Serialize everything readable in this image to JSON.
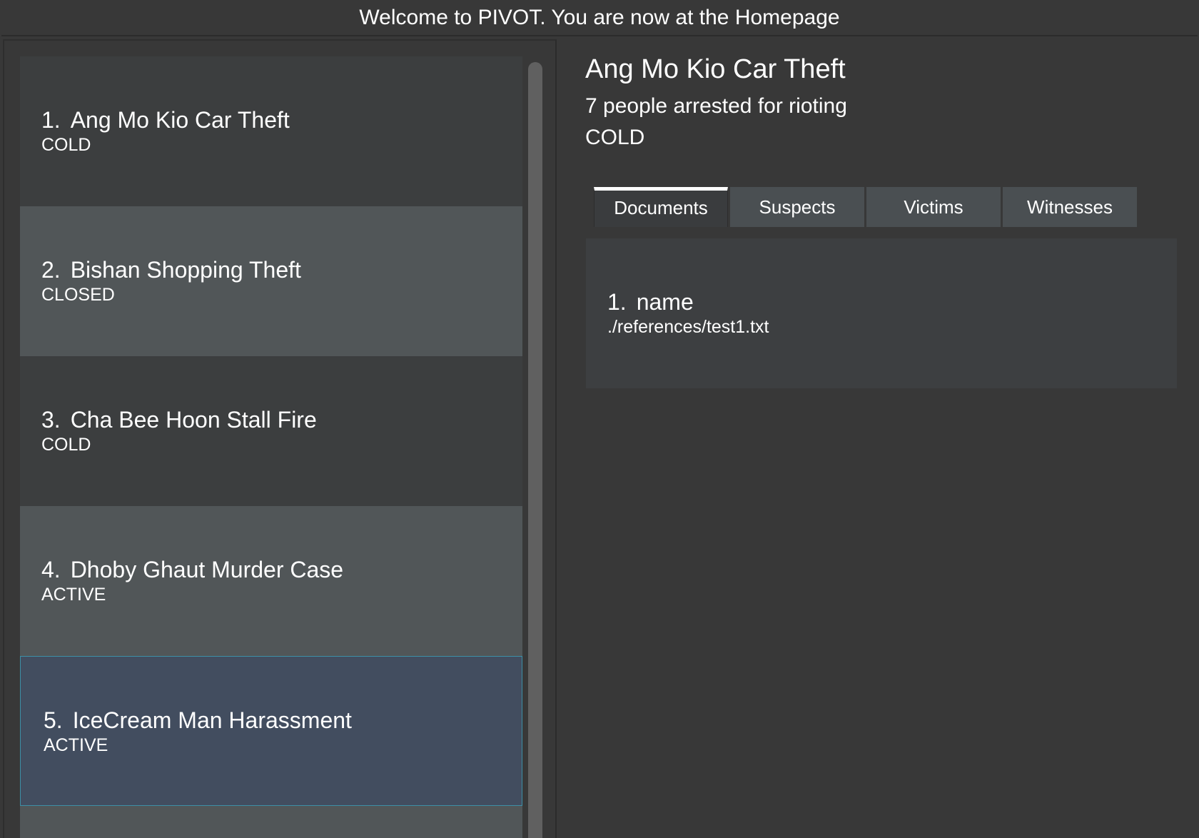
{
  "status_bar": {
    "message": "Welcome to PIVOT. You are now at the Homepage"
  },
  "case_list": {
    "items": [
      {
        "index": "1.",
        "title": "Ang Mo Kio Car Theft",
        "status": "COLD"
      },
      {
        "index": "2.",
        "title": "Bishan Shopping Theft",
        "status": "CLOSED"
      },
      {
        "index": "3.",
        "title": "Cha Bee Hoon Stall Fire",
        "status": "COLD"
      },
      {
        "index": "4.",
        "title": "Dhoby Ghaut Murder Case",
        "status": "ACTIVE"
      },
      {
        "index": "5.",
        "title": "IceCream Man Harassment",
        "status": "ACTIVE"
      }
    ],
    "selected_index": 5
  },
  "case_detail": {
    "title": "Ang Mo Kio Car Theft",
    "description": "7 people arrested for rioting",
    "status": "COLD",
    "tabs": [
      {
        "label": "Documents",
        "active": true
      },
      {
        "label": "Suspects",
        "active": false
      },
      {
        "label": "Victims",
        "active": false
      },
      {
        "label": "Witnesses",
        "active": false
      }
    ],
    "documents": [
      {
        "index": "1.",
        "name": "name",
        "path": "./references/test1.txt"
      }
    ]
  },
  "colors": {
    "background": "#383838",
    "card_dark": "#3c3e3f",
    "card_light": "#515658",
    "card_selected": "#424d5f",
    "selected_border": "#3d8fa6"
  }
}
